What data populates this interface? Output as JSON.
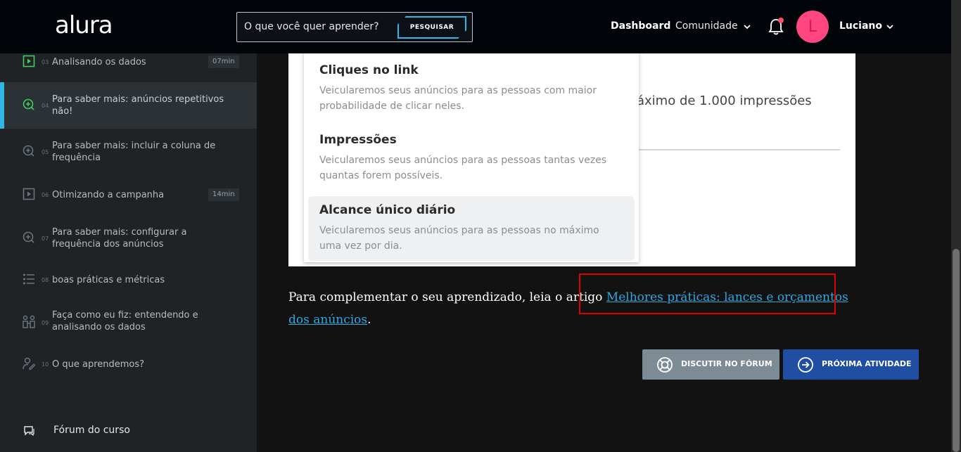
{
  "header": {
    "logo": "alura",
    "search_placeholder": "O que você quer aprender?",
    "search_button": "PESQUISAR",
    "nav_dashboard": "Dashboard",
    "nav_community": "Comunidade",
    "avatar_letter": "L",
    "user_name": "Luciano"
  },
  "sidebar": {
    "lessons": [
      {
        "num": "03",
        "title": "Analisando os dados",
        "duration": "07min",
        "icon": "video-icon"
      },
      {
        "num": "04",
        "title": "Para saber mais: anúncios repetitivos não!",
        "duration": "",
        "icon": "plus-circle-icon"
      },
      {
        "num": "05",
        "title": "Para saber mais: incluir a coluna de frequência",
        "duration": "",
        "icon": "plus-circle-icon"
      },
      {
        "num": "06",
        "title": "Otimizando a campanha",
        "duration": "14min",
        "icon": "video-icon"
      },
      {
        "num": "07",
        "title": "Para saber mais: configurar a frequência dos anúncios",
        "duration": "",
        "icon": "plus-circle-icon"
      },
      {
        "num": "08",
        "title": "boas práticas e métricas",
        "duration": "",
        "icon": "list-icon"
      },
      {
        "num": "09",
        "title": "Faça como eu fiz: entendendo e analisando os dados",
        "duration": "",
        "icon": "people-icon"
      },
      {
        "num": "10",
        "title": "O que aprendemos?",
        "duration": "",
        "icon": "user-edit-icon"
      }
    ],
    "forum_label": "Fórum do curso"
  },
  "screenshot": {
    "bg_text": "áximo de 1.000 impressões",
    "options": [
      {
        "title": "Cliques no link",
        "desc": "Veicularemos seus anúncios para as pessoas com maior probabilidade de clicar neles."
      },
      {
        "title": "Impressões",
        "desc": "Veicularemos seus anúncios para as pessoas tantas vezes quantas forem possíveis."
      },
      {
        "title": "Alcance único diário",
        "desc": "Veicularemos seus anúncios para as pessoas no máximo uma vez por dia."
      }
    ]
  },
  "content": {
    "para_prefix": "Para complementar o seu aprendizado, leia o artigo ",
    "link_text": "Melhores práticas: lances e orçamentos dos anúncios",
    "para_suffix": ".",
    "btn_forum": "DISCUTIR NO FÓRUM",
    "btn_next": "PRÓXIMA ATIVIDADE"
  },
  "colors": {
    "accent": "#2fb7e8",
    "avatar": "#ff4680",
    "next_button": "#1f4ea3",
    "forum_button": "#7d8b94",
    "highlight": "#e00000"
  }
}
